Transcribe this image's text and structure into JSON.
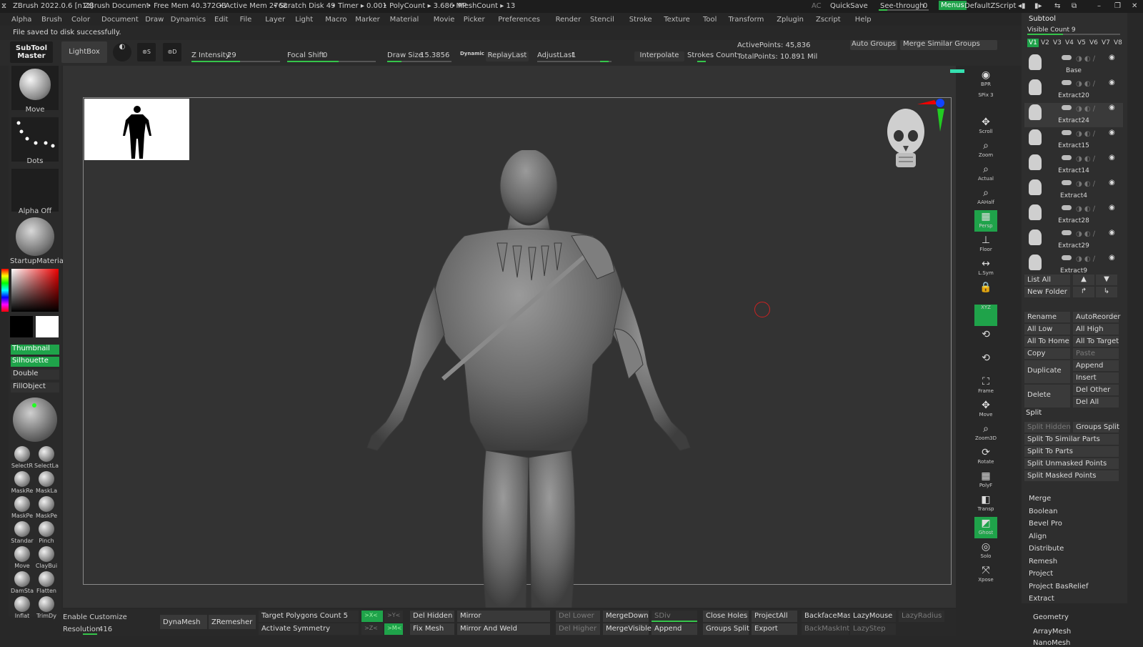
{
  "title": {
    "app": "ZBrush 2022.0.6 [n1z]",
    "doc": "ZBrush Document",
    "free_mem": "• Free Mem 40.372GB",
    "active_mem": "• Active Mem 2768",
    "scratch": "• Scratch Disk 49",
    "timer": "• Timer ▸ 0.001",
    "polycount": "• PolyCount ▸ 3.686 MP",
    "meshcount": "• MeshCount ▸ 13",
    "ac": "AC",
    "quicksave": "QuickSave",
    "see_through_label": "See-through",
    "see_through_value": "0",
    "menus": "Menus",
    "script": "DefaultZScript"
  },
  "menu": [
    "Alpha",
    "Brush",
    "Color",
    "Document",
    "Draw",
    "Dynamics",
    "Edit",
    "File",
    "Layer",
    "Light",
    "Macro",
    "Marker",
    "Material",
    "Movie",
    "Picker",
    "Preferences",
    "Render",
    "Stencil",
    "Stroke",
    "Texture",
    "Tool",
    "Transform",
    "Zplugin",
    "Zscript",
    "Help"
  ],
  "status_message": "File saved to disk successfully.",
  "top_shelf": {
    "subtool_master": "SubTool Master",
    "lightbox": "LightBox",
    "z_intensity_label": "Z Intensity",
    "z_intensity_value": "29",
    "focal_shift_label": "Focal Shift",
    "focal_shift_value": "0",
    "draw_size_label": "Draw Size",
    "draw_size_value": "15.3856",
    "dynamic": "Dynamic",
    "replay_last": "ReplayLast",
    "adjust_last_label": "AdjustLast",
    "adjust_last_value": "1",
    "interpolate": "Interpolate",
    "strokes_count": "Strokes Count",
    "active_points": "ActivePoints: 45,836",
    "total_points": "TotalPoints: 10.891 Mil",
    "auto_groups": "Auto Groups",
    "merge_similar": "Merge Similar Groups"
  },
  "left_shelf": {
    "brush": "Move",
    "stroke": "Dots",
    "alpha": "Alpha Off",
    "material": "StartupMateria",
    "thumbnail": "Thumbnail",
    "silhouette": "Silhouette",
    "double": "Double",
    "fill_object": "FillObject",
    "brushes": [
      "SelectR",
      "SelectLa",
      "MaskRe",
      "MaskLa",
      "MaskPe",
      "MaskPe",
      "Standar",
      "Pinch",
      "Move",
      "ClayBui",
      "DamSta",
      "Flatten",
      "Inflat",
      "TrimDy"
    ]
  },
  "right_shelf": [
    "BPR",
    "SPix 3",
    "Scroll",
    "Zoom",
    "Actual",
    "AAHalf",
    "Persp",
    "Floor",
    "L.Sym",
    "",
    "XYZ",
    "",
    "",
    "Frame",
    "Move",
    "Zoom3D",
    "Rotate",
    "PolyF",
    "Transp",
    "Ghost",
    "Solo",
    "Xpose"
  ],
  "subtool": {
    "header": "Subtool",
    "visible_count": "Visible Count 9",
    "versions": [
      "V1",
      "V2",
      "V3",
      "V4",
      "V5",
      "V6",
      "V7",
      "V8"
    ],
    "items": [
      "Base",
      "Extract20",
      "Extract24",
      "Extract15",
      "Extract14",
      "Extract4",
      "Extract28",
      "Extract29",
      "Extract9"
    ],
    "list_all": "List All",
    "new_folder": "New Folder",
    "rename": "Rename",
    "auto_reorder": "AutoReorder",
    "all_low": "All Low",
    "all_high": "All High",
    "all_to_home": "All To Home",
    "all_to_target": "All To Target",
    "copy": "Copy",
    "paste": "Paste",
    "append": "Append",
    "duplicate": "Duplicate",
    "insert": "Insert",
    "del_other": "Del Other",
    "delete": "Delete",
    "del_all": "Del All",
    "split": "Split",
    "split_hidden": "Split Hidden",
    "groups_split": "Groups Split",
    "split_similar": "Split To Similar Parts",
    "split_parts": "Split To Parts",
    "split_unmasked": "Split Unmasked Points",
    "split_masked": "Split Masked Points",
    "merge": "Merge",
    "boolean": "Boolean",
    "bevel_pro": "Bevel Pro",
    "align": "Align",
    "distribute": "Distribute",
    "remesh": "Remesh",
    "project": "Project",
    "project_bas": "Project BasRelief",
    "extract": "Extract",
    "geometry": "Geometry",
    "array_mesh": "ArrayMesh",
    "nano_mesh": "NanoMesh"
  },
  "bottom": {
    "enable_customize": "Enable Customize",
    "resolution_label": "Resolution",
    "resolution_value": "416",
    "dynamesh": "DynaMesh",
    "zremesher": "ZRemesher",
    "target_polys": "Target Polygons Count 5",
    "activate_symmetry": "Activate Symmetry",
    "x": ">X<",
    "y": ">Y<",
    "z": ">Z<",
    "m": ">M<",
    "del_hidden": "Del Hidden",
    "fix_mesh": "Fix Mesh",
    "mirror": "Mirror",
    "mirror_weld": "Mirror And Weld",
    "del_lower": "Del Lower",
    "del_higher": "Del Higher",
    "merge_down": "MergeDown",
    "merge_visible": "MergeVisible",
    "sdiv": "SDiv",
    "append": "Append",
    "close_holes": "Close Holes",
    "groups_split": "Groups Split",
    "project_all": "ProjectAll",
    "export": "Export",
    "backface_mask": "BackfaceMask",
    "backmask_int": "BackMaskInt",
    "lazy_mouse": "LazyMouse",
    "lazy_step": "LazyStep",
    "lazy_radius": "LazyRadius"
  },
  "colors": {
    "accent": "#1fa34a",
    "slider": "#35c54a",
    "menus": "#1fa34a"
  }
}
